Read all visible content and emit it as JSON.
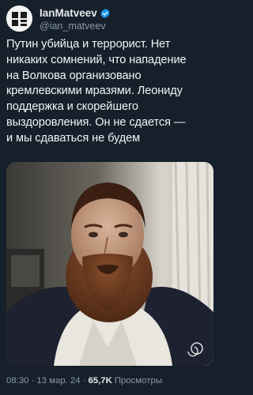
{
  "author": {
    "display_name": "IanMatveev",
    "handle": "@ian_matveev",
    "avatar_icon": "author-avatar-icon"
  },
  "tweet": {
    "text": "Путин убийца и террорист. Нет\nникаких сомнений, что нападение\nна Волкова организовано\nкремлевскими мразями. Леониду\nподдержка и скорейшего\nвыздоровления. Он не сдается —\nи мы сдаваться не будем"
  },
  "meta": {
    "time": "08:30",
    "separator": "·",
    "date": "13 мар. 24",
    "views_count": "65,7K",
    "views_label": "Просмотры"
  },
  "colors": {
    "background": "#15202b",
    "text": "#e7e9ea",
    "secondary": "#8b98a5",
    "verified": "#1d9bf0"
  }
}
